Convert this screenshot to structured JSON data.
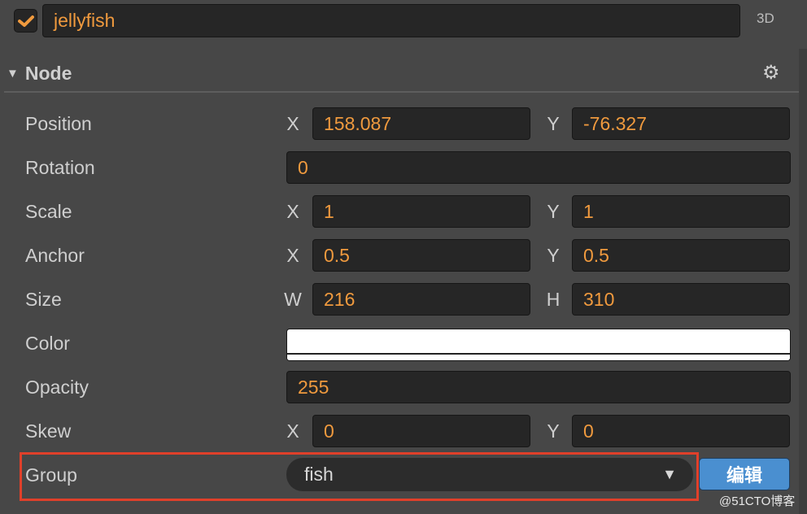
{
  "node": {
    "enabled": true,
    "name": "jellyfish",
    "mode_label": "3D"
  },
  "section": {
    "title": "Node",
    "settings_icon": "gear-icon"
  },
  "props": [
    {
      "label": "Position",
      "a_axis": "X",
      "a": "158.087",
      "b_axis": "Y",
      "b": "-76.327"
    },
    {
      "label": "Rotation",
      "value": "0"
    },
    {
      "label": "Scale",
      "a_axis": "X",
      "a": "1",
      "b_axis": "Y",
      "b": "1"
    },
    {
      "label": "Anchor",
      "a_axis": "X",
      "a": "0.5",
      "b_axis": "Y",
      "b": "0.5"
    },
    {
      "label": "Size",
      "a_axis": "W",
      "a": "216",
      "b_axis": "H",
      "b": "310"
    },
    {
      "label": "Color",
      "color": "#ffffff"
    },
    {
      "label": "Opacity",
      "value": "255"
    },
    {
      "label": "Skew",
      "a_axis": "X",
      "a": "0",
      "b_axis": "Y",
      "b": "0"
    }
  ],
  "group": {
    "label": "Group",
    "value": "fish",
    "edit_button": "编辑"
  },
  "watermark": "@51CTO博客",
  "colors": {
    "accent": "#f09a3e",
    "highlight_box": "#e0402a",
    "button": "#4a8fd0"
  }
}
